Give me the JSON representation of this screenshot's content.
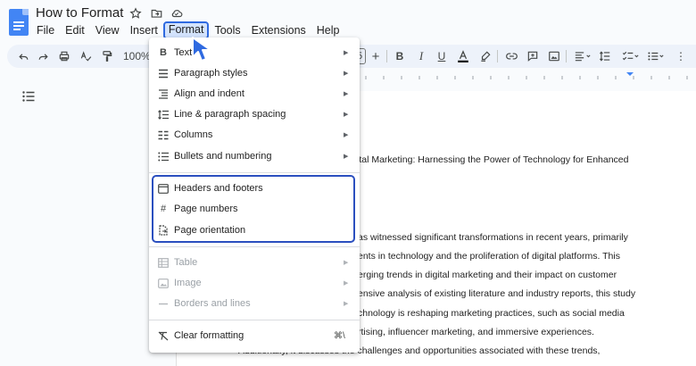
{
  "document": {
    "title": "How to Format"
  },
  "menubar": {
    "items": [
      "File",
      "Edit",
      "View",
      "Insert",
      "Format",
      "Tools",
      "Extensions",
      "Help"
    ],
    "active": "Format"
  },
  "toolbar": {
    "zoom": "100%",
    "font_size": "5"
  },
  "format_menu": {
    "items": [
      {
        "label": "Text",
        "icon": "bold-icon",
        "submenu": true
      },
      {
        "label": "Paragraph styles",
        "icon": "paragraph-styles-icon",
        "submenu": true
      },
      {
        "label": "Align and indent",
        "icon": "align-indent-icon",
        "submenu": true
      },
      {
        "label": "Line & paragraph spacing",
        "icon": "line-spacing-icon",
        "submenu": true
      },
      {
        "label": "Columns",
        "icon": "columns-icon",
        "submenu": true
      },
      {
        "label": "Bullets and numbering",
        "icon": "bullets-icon",
        "submenu": true
      },
      {
        "label": "Headers and footers",
        "icon": "header-footer-icon",
        "submenu": false
      },
      {
        "label": "Page numbers",
        "icon": "hash-icon",
        "submenu": false
      },
      {
        "label": "Page orientation",
        "icon": "page-orientation-icon",
        "submenu": false
      },
      {
        "label": "Table",
        "icon": "table-icon",
        "submenu": true,
        "disabled": true
      },
      {
        "label": "Image",
        "icon": "image-icon",
        "submenu": true,
        "disabled": true
      },
      {
        "label": "Borders and lines",
        "icon": "borders-icon",
        "submenu": true,
        "disabled": true
      },
      {
        "label": "Clear formatting",
        "icon": "clear-formatting-icon",
        "shortcut": "⌘\\"
      }
    ],
    "highlight_color": "#2b4fbf"
  },
  "body_text": [
    "ital Marketing: Harnessing the Power of Technology for Enhanced",
    "as witnessed significant transformations in recent years, primarily",
    "ents in technology and the proliferation of digital platforms. This",
    "erging trends in digital marketing and their impact on customer",
    "ensive analysis of existing literature and industry reports, this study",
    "chnology is reshaping marketing practices, such as social media",
    "rtising, influencer marketing, and immersive experiences.",
    "Additionally, it discusses the challenges and opportunities associated with these trends,"
  ],
  "colors": {
    "accent": "#2f6ae0",
    "toolbar_bg": "#edf2fa",
    "doc_icon": "#4285f4"
  }
}
